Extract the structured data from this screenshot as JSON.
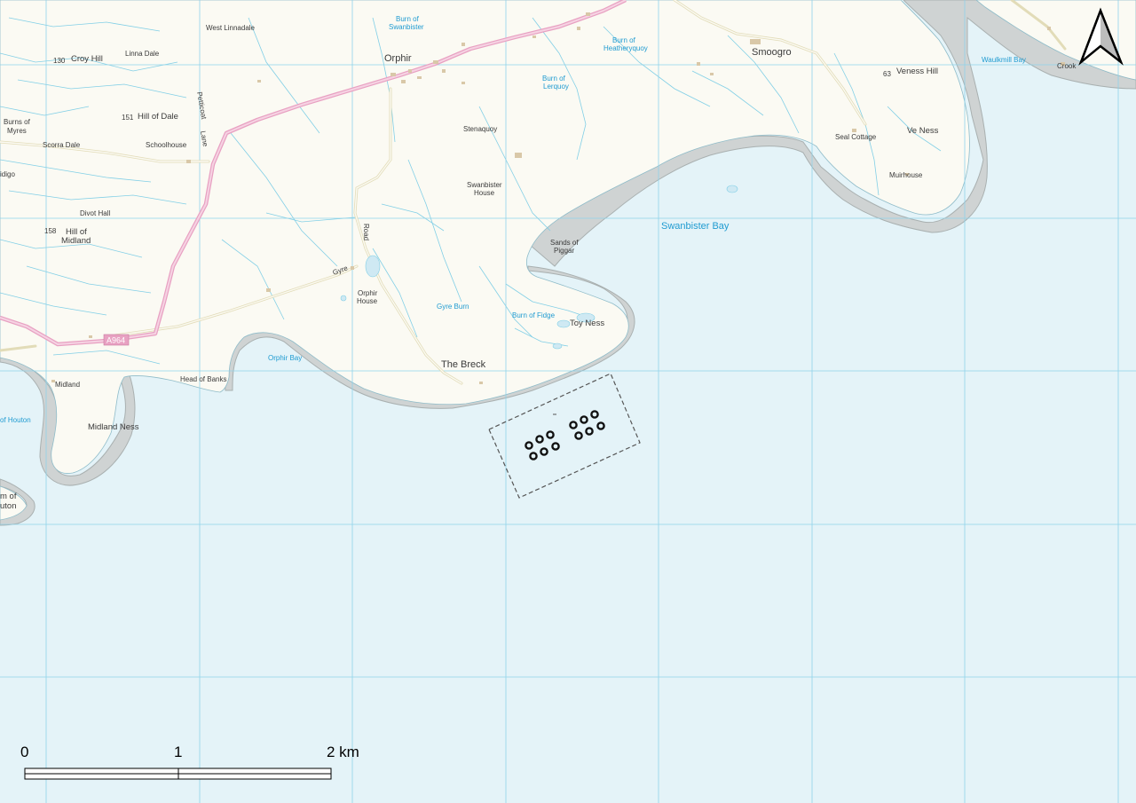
{
  "map": {
    "colors": {
      "land": "#fbfaf3",
      "sea": "#e4f3f8",
      "road_a": "#e8a1c2",
      "minor_road": "#efe9c8",
      "stream": "#82cfe6",
      "grid": "#8fd3ea",
      "foreshore": "#cfd3d3"
    },
    "labels": {
      "west_linnadale": "West Linnadale",
      "croy_hill_height": "130",
      "croy_hill": "Croy Hill",
      "linna_dale": "Linna Dale",
      "hill_of_dale_height": "151",
      "hill_of_dale": "Hill of Dale",
      "burns_of_myres": "Burns of",
      "burns_of_myres_2": "Myres",
      "scorra_dale": "Scorra Dale",
      "schoolhouse": "Schoolhouse",
      "idigo": "idigo",
      "divot_hall": "Divot Hall",
      "hill_of_midland_height": "158",
      "hill_of_midland": "Hill of",
      "hill_of_midland_2": "Midland",
      "midland": "Midland",
      "head_of_banks": "Head of Banks",
      "midland_ness": "Midland Ness",
      "bay_of_houton": "of Houton",
      "holm_of_houton": "m of",
      "holm_of_houton_2": "uton",
      "orphir": "Orphir",
      "petticoat_lane": "Petticoat",
      "petticoat_lane_2": "Lane",
      "burn_of_swanbister": "Burn of",
      "burn_of_swanbister_2": "Swanbister",
      "burn_of_heatheryquoy": "Burn of",
      "burn_of_heatheryquoy_2": "Heatheryquoy",
      "burn_of_lerquoy": "Burn of",
      "burn_of_lerquoy_2": "Lerquoy",
      "smoogro": "Smoogro",
      "veness_hill_height": "63",
      "veness_hill": "Veness Hill",
      "waulkmill_bay": "Waulkmill Bay",
      "crook": "Crook",
      "stenaquoy": "Stenaquoy",
      "swanbister_house": "Swanbister",
      "swanbister_house_2": "House",
      "seal_cottage": "Seal Cottage",
      "ve_ness": "Ve Ness",
      "muirhouse": "Muirhouse",
      "swanbister_bay": "Swanbister Bay",
      "sands_of_piggar": "Sands of",
      "sands_of_piggar_2": "Piggar",
      "road_label": "Road",
      "gyre": "Gyre",
      "orphir_house": "Orphir",
      "orphir_house_2": "House",
      "gyre_burn": "Gyre Burn",
      "burn_of_fidge": "Burn of Fidge",
      "toy_ness": "Toy Ness",
      "orphir_bay": "Orphir Bay",
      "the_breck": "The Breck",
      "a964": "A964"
    },
    "site": {
      "turbine_count": 12
    },
    "scale_bar": {
      "labels": [
        "0",
        "1",
        "2 km"
      ]
    },
    "north_arrow": {
      "icon": "north-arrow-icon"
    }
  }
}
